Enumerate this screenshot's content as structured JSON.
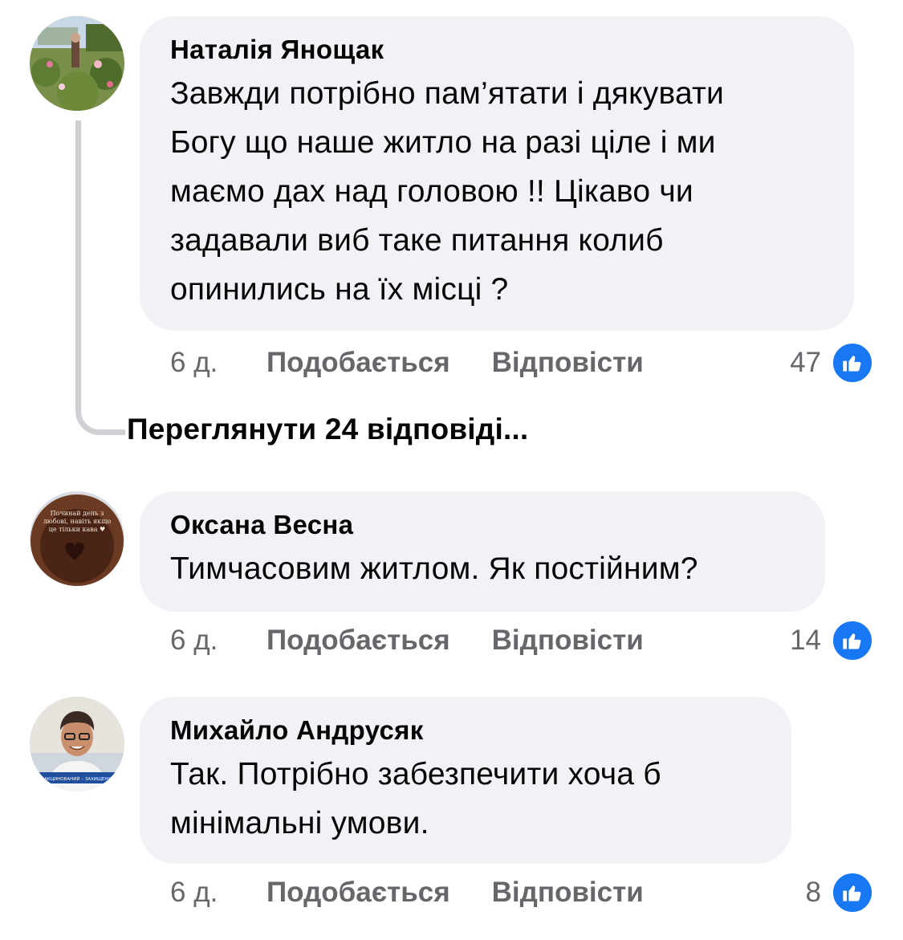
{
  "comments": [
    {
      "author": "Наталія Янощак",
      "lines": [
        "Завжди потрібно пам’ятати і дякувати",
        "Богу що наше житло на разі ціле і ми",
        "маємо дах над головою !! Цікаво чи",
        "задавали виб таке питання колиб",
        "опинились на їх місці ?"
      ],
      "time": "6 д.",
      "like_label": "Подобається",
      "reply_label": "Відповісти",
      "reactions": "47"
    },
    {
      "author": "Оксана Весна",
      "lines": [
        "Тимчасовим житлом. Як постійним?"
      ],
      "time": "6 д.",
      "like_label": "Подобається",
      "reply_label": "Відповісти",
      "reactions": "14",
      "avatar_text": [
        "Починай день з",
        "любові, навіть якщо",
        "це тільки кава ♥"
      ]
    },
    {
      "author": "Михайло Андрусяк",
      "lines": [
        "Так.  Потрібно забезпечити хоча б",
        "мінімальні умови."
      ],
      "time": "6 д.",
      "like_label": "Подобається",
      "reply_label": "Відповісти",
      "reactions": "8",
      "avatar_banner": "ВАКЦИНОВАНИЙ – ЗАХИЩЕНИЙ"
    }
  ],
  "view_replies": "Переглянути 24 відповіді...",
  "colors": {
    "bubble": "#f0f2f5",
    "meta": "#65676b",
    "like_blue": "#1877f2",
    "thread_line": "#ced0d4"
  },
  "icons": [
    "thumbs-up-icon"
  ]
}
